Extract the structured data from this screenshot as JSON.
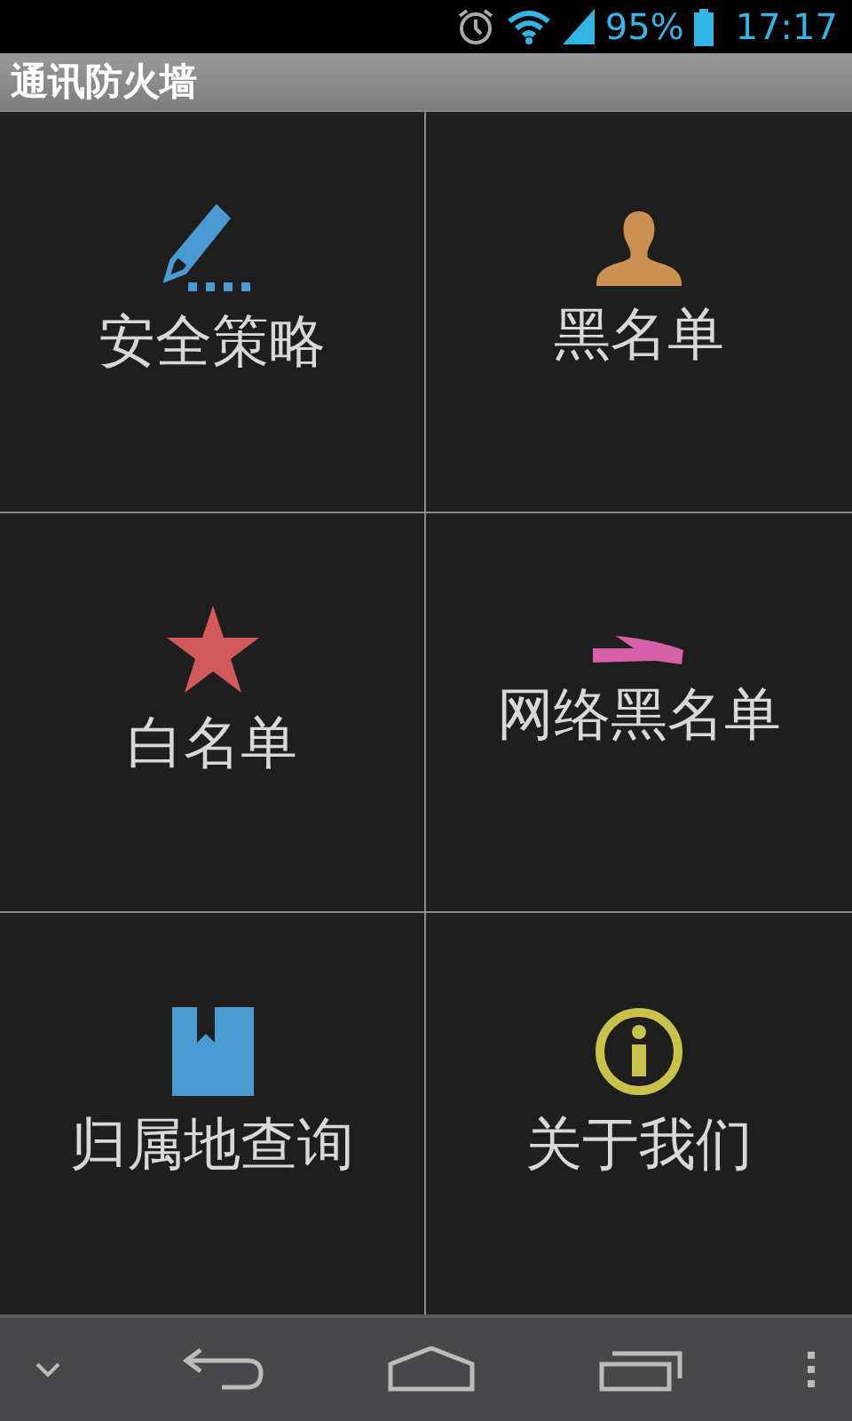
{
  "status_bar": {
    "battery": "95%",
    "time": "17:17"
  },
  "title_bar": {
    "title": "通讯防火墙"
  },
  "tiles": [
    {
      "label": "安全策略"
    },
    {
      "label": "黑名单"
    },
    {
      "label": "白名单"
    },
    {
      "label": "网络黑名单"
    },
    {
      "label": "归属地查询"
    },
    {
      "label": "关于我们"
    }
  ]
}
